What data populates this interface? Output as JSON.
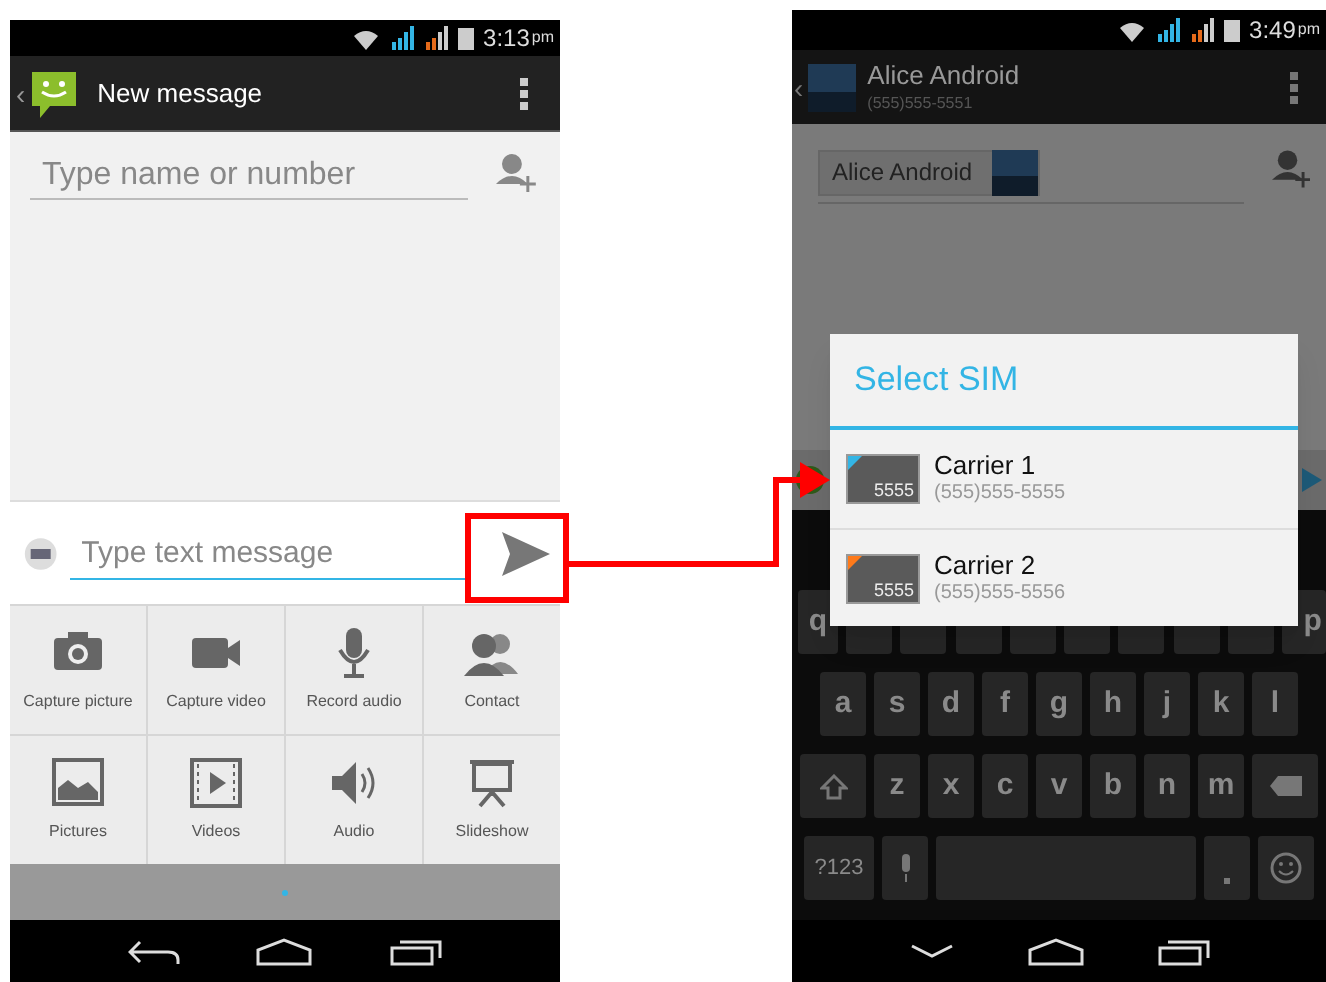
{
  "left_phone": {
    "status_bar": {
      "time": "3:13",
      "ampm": "pm"
    },
    "action_bar": {
      "back": "‹",
      "title": "New message"
    },
    "recipient_field": {
      "placeholder": "Type name or number"
    },
    "compose": {
      "placeholder": "Type text message",
      "highlighted": true
    },
    "attachments": [
      {
        "label": "Capture picture",
        "kind": "camera"
      },
      {
        "label": "Capture video",
        "kind": "video"
      },
      {
        "label": "Record audio",
        "kind": "mic"
      },
      {
        "label": "Contact",
        "kind": "contact"
      },
      {
        "label": "Pictures",
        "kind": "picture"
      },
      {
        "label": "Videos",
        "kind": "film"
      },
      {
        "label": "Audio",
        "kind": "speaker"
      },
      {
        "label": "Slideshow",
        "kind": "slideshow"
      }
    ]
  },
  "right_phone": {
    "status_bar": {
      "time": "3:49",
      "ampm": "pm"
    },
    "action_bar": {
      "back": "‹",
      "title": "Alice Android",
      "subtitle": "(555)555-5551"
    },
    "recipient_chip": "Alice Android",
    "dialog": {
      "title": "Select SIM",
      "sims": [
        {
          "name": "Carrier 1",
          "number": "(555)555-5555",
          "badge": "5555",
          "color": "#33b5e5"
        },
        {
          "name": "Carrier 2",
          "number": "(555)555-5556",
          "badge": "5555",
          "color": "#ff7a1a"
        }
      ]
    },
    "keyboard": {
      "top_row_first": "q",
      "top_row_last": "p",
      "home_row": [
        "a",
        "s",
        "d",
        "f",
        "g",
        "h",
        "j",
        "k",
        "l"
      ],
      "lower_row": [
        "z",
        "x",
        "c",
        "v",
        "b",
        "n",
        "m"
      ],
      "symbols_key": "?123"
    }
  }
}
